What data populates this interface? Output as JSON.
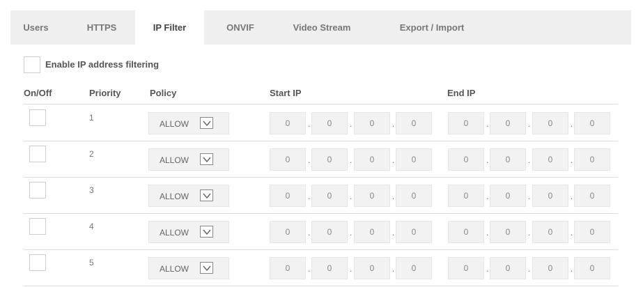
{
  "tabs": [
    {
      "label": "Users",
      "active": false
    },
    {
      "label": "HTTPS",
      "active": false
    },
    {
      "label": "IP Filter",
      "active": true
    },
    {
      "label": "ONVIF",
      "active": false
    },
    {
      "label": "Video Stream",
      "active": false
    },
    {
      "label": "Export / Import",
      "active": false
    }
  ],
  "enable_filtering": {
    "label": "Enable IP address filtering",
    "checked": false
  },
  "columns": {
    "on_off": "On/Off",
    "priority": "Priority",
    "policy": "Policy",
    "start_ip": "Start IP",
    "end_ip": "End IP"
  },
  "rows": [
    {
      "enabled": false,
      "priority": "1",
      "policy": "ALLOW",
      "start_ip": [
        "0",
        "0",
        "0",
        "0"
      ],
      "end_ip": [
        "0",
        "0",
        "0",
        "0"
      ]
    },
    {
      "enabled": false,
      "priority": "2",
      "policy": "ALLOW",
      "start_ip": [
        "0",
        "0",
        "0",
        "0"
      ],
      "end_ip": [
        "0",
        "0",
        "0",
        "0"
      ]
    },
    {
      "enabled": false,
      "priority": "3",
      "policy": "ALLOW",
      "start_ip": [
        "0",
        "0",
        "0",
        "0"
      ],
      "end_ip": [
        "0",
        "0",
        "0",
        "0"
      ]
    },
    {
      "enabled": false,
      "priority": "4",
      "policy": "ALLOW",
      "start_ip": [
        "0",
        "0",
        "0",
        "0"
      ],
      "end_ip": [
        "0",
        "0",
        "0",
        "0"
      ]
    },
    {
      "enabled": false,
      "priority": "5",
      "policy": "ALLOW",
      "start_ip": [
        "0",
        "0",
        "0",
        "0"
      ],
      "end_ip": [
        "0",
        "0",
        "0",
        "0"
      ]
    }
  ],
  "ip_separator": ".",
  "icons": {
    "policy_dropdown": "chevron-down-icon"
  },
  "colors": {
    "frame_bg": "#efefef",
    "panel_bg": "#ffffff",
    "field_bg": "#f2f2f2",
    "text": "#555555"
  }
}
